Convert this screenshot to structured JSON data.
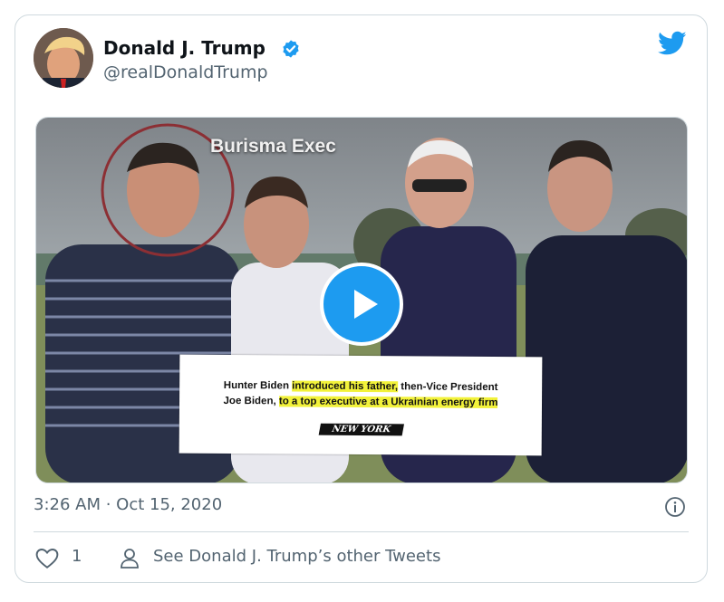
{
  "author": {
    "name": "Donald J. Trump",
    "handle": "@realDonaldTrump"
  },
  "media": {
    "overlay_label": "Burisma Exec",
    "caption_line1_a": "Hunter Biden ",
    "caption_line1_b": "introduced his father,",
    "caption_line1_c": " then-Vice President",
    "caption_line2_a": "Joe Biden, ",
    "caption_line2_b": "to a top executive at a Ukrainian energy firm",
    "source_logo": "NEW YORK POST"
  },
  "timestamp": "3:26 AM · Oct 15, 2020",
  "actions": {
    "like_count": "1",
    "see_other": "See Donald J. Trump’s other Tweets"
  },
  "colors": {
    "brand": "#1d9bf0",
    "secondary_text": "#536471",
    "border": "#cfd9de"
  },
  "icons": [
    "verified-badge-icon",
    "twitter-bird-icon",
    "play-icon",
    "info-icon",
    "heart-icon",
    "person-icon"
  ]
}
